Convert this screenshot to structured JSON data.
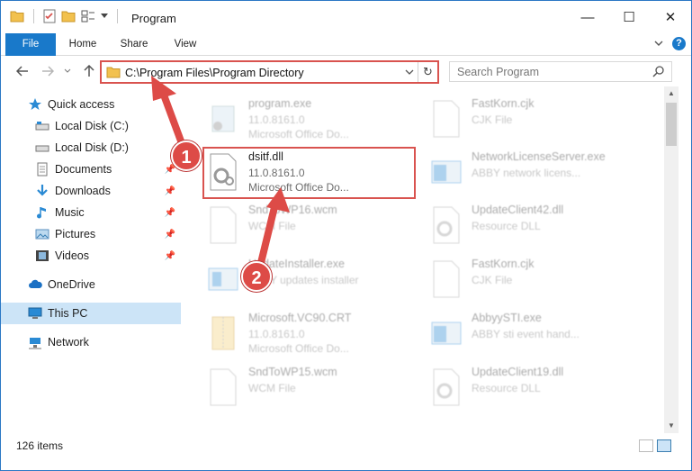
{
  "window": {
    "title": "Program",
    "controls": {
      "minimize": "—",
      "maximize": "☐",
      "close": "✕"
    }
  },
  "ribbon": {
    "tabs": [
      "File",
      "Home",
      "Share",
      "View"
    ]
  },
  "address": {
    "path": "C:\\Program Files\\Program Directory",
    "refresh_glyph": "↻"
  },
  "search": {
    "placeholder": "Search Program"
  },
  "nav": {
    "items": [
      {
        "label": "Quick access",
        "icon": "star-icon"
      },
      {
        "label": "Local Disk (C:)",
        "icon": "drive-icon",
        "pinned": true
      },
      {
        "label": "Local Disk (D:)",
        "icon": "drive-icon",
        "pinned": true
      },
      {
        "label": "Documents",
        "icon": "documents-icon",
        "pinned": true
      },
      {
        "label": "Downloads",
        "icon": "download-icon",
        "pinned": true
      },
      {
        "label": "Music",
        "icon": "music-icon",
        "pinned": true
      },
      {
        "label": "Pictures",
        "icon": "pictures-icon",
        "pinned": true
      },
      {
        "label": "Videos",
        "icon": "videos-icon",
        "pinned": true
      },
      {
        "label": "OneDrive",
        "icon": "cloud-icon"
      },
      {
        "label": "This PC",
        "icon": "computer-icon",
        "selected": true
      },
      {
        "label": "Network",
        "icon": "network-icon"
      }
    ]
  },
  "files": {
    "left_column": [
      {
        "name": "program.exe",
        "line2": "11.0.8161.0",
        "line3": "Microsoft Office Do...",
        "icon": "exe-icon"
      },
      {
        "name": "dsitf.dll",
        "line2": "11.0.8161.0",
        "line3": "Microsoft Office Do...",
        "icon": "dll-gear-icon",
        "highlighted": true
      },
      {
        "name": "SndToWP16.wcm",
        "line2": "WCM File",
        "line3": "",
        "icon": "blank-file-icon"
      },
      {
        "name": "UpdateInstaller.exe",
        "line2": "ABBY updates installer",
        "line3": "",
        "icon": "installer-icon"
      },
      {
        "name": "Microsoft.VC90.CRT",
        "line2": "11.0.8161.0",
        "line3": "Microsoft Office Do...",
        "icon": "zip-folder-icon"
      },
      {
        "name": "SndToWP15.wcm",
        "line2": "WCM File",
        "line3": "",
        "icon": "blank-file-icon"
      }
    ],
    "right_column": [
      {
        "name": "FastKorn.cjk",
        "line2": "CJK File",
        "line3": "",
        "icon": "blank-file-icon"
      },
      {
        "name": "NetworkLicenseServer.exe",
        "line2": "ABBY network licens...",
        "line3": "",
        "icon": "app-window-icon"
      },
      {
        "name": "UpdateClient42.dll",
        "line2": "Resource DLL",
        "line3": "",
        "icon": "dll-gear-icon"
      },
      {
        "name": "FastKorn.cjk",
        "line2": "CJK File",
        "line3": "",
        "icon": "blank-file-icon"
      },
      {
        "name": "AbbyySTI.exe",
        "line2": "ABBY sti event hand...",
        "line3": "",
        "icon": "app-window-icon"
      },
      {
        "name": "UpdateClient19.dll",
        "line2": "Resource DLL",
        "line3": "",
        "icon": "dll-gear-icon"
      }
    ]
  },
  "status": {
    "item_count": "126 items"
  },
  "annotations": {
    "step1": "1",
    "step2": "2",
    "accent_color": "#dd4b47"
  },
  "colors": {
    "file_tab": "#1979ca",
    "selected_nav": "#cce4f7",
    "border": "#2b78c5"
  }
}
